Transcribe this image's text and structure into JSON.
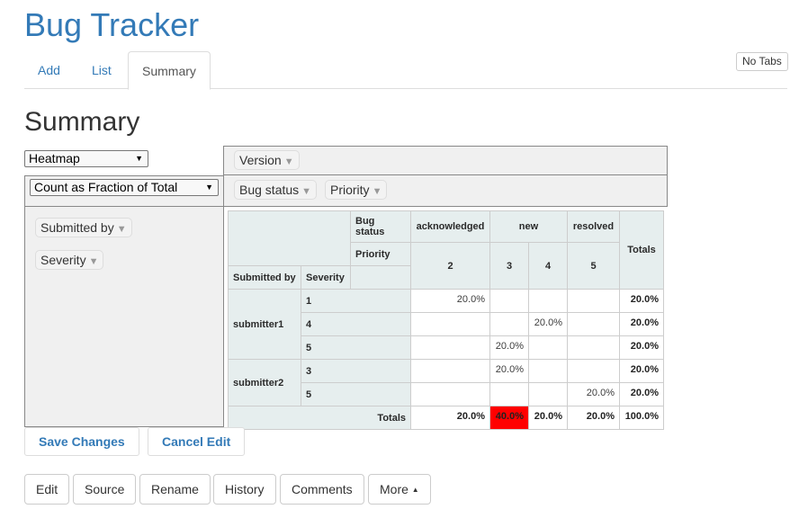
{
  "app": {
    "title": "Bug Tracker"
  },
  "tabs": [
    {
      "label": "Add",
      "active": false
    },
    {
      "label": "List",
      "active": false
    },
    {
      "label": "Summary",
      "active": true
    }
  ],
  "no_tabs_label": "No Tabs",
  "page_title": "Summary",
  "pivot": {
    "renderer": "Heatmap",
    "aggregator": "Count as Fraction of Total",
    "column_attrs": [
      "Version"
    ],
    "col_attrs_row2": [
      "Bug status",
      "Priority"
    ],
    "unused_attrs": [
      "Submitted by",
      "Severity"
    ],
    "table": {
      "col_header_1": "Bug status",
      "col_header_2": "Priority",
      "row_header_1": "Submitted by",
      "row_header_2": "Severity",
      "status_groups": [
        "acknowledged",
        "new",
        "resolved"
      ],
      "priorities": [
        "2",
        "3",
        "4",
        "5"
      ],
      "totals_label": "Totals",
      "rows": [
        {
          "submitter": "submitter1",
          "severity": "1",
          "cells": [
            "20.0%",
            "",
            "",
            ""
          ],
          "total": "20.0%"
        },
        {
          "submitter": "",
          "severity": "4",
          "cells": [
            "",
            "",
            "20.0%",
            ""
          ],
          "total": "20.0%"
        },
        {
          "submitter": "",
          "severity": "5",
          "cells": [
            "",
            "20.0%",
            "",
            ""
          ],
          "total": "20.0%"
        },
        {
          "submitter": "submitter2",
          "severity": "3",
          "cells": [
            "",
            "20.0%",
            "",
            ""
          ],
          "total": "20.0%"
        },
        {
          "submitter": "",
          "severity": "5",
          "cells": [
            "",
            "",
            "",
            "20.0%"
          ],
          "total": "20.0%"
        }
      ],
      "col_totals": [
        "20.0%",
        "40.0%",
        "20.0%",
        "20.0%"
      ],
      "grand_total": "100.0%",
      "heat_color": "#ff0000"
    }
  },
  "buttons": {
    "save": "Save Changes",
    "cancel": "Cancel Edit"
  },
  "actions": [
    "Edit",
    "Source",
    "Rename",
    "History",
    "Comments",
    "More"
  ],
  "colors": {
    "link": "#337ab7",
    "header_bg": "#e6eeee"
  }
}
